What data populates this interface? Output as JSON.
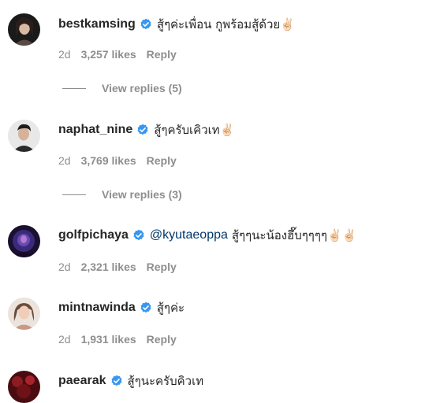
{
  "comments": [
    {
      "username": "bestkamsing",
      "mention": "",
      "text": "สู้ๆค่ะเพื่อน กูพร้อมสู้ด้วย✌🏻",
      "time": "2d",
      "likes": "3,257 likes",
      "reply_label": "Reply",
      "view_replies": "View replies (5)"
    },
    {
      "username": "naphat_nine",
      "mention": "",
      "text": "สู้ๆครับเคิวเท✌🏻",
      "time": "2d",
      "likes": "3,769 likes",
      "reply_label": "Reply",
      "view_replies": "View replies (3)"
    },
    {
      "username": "golfpichaya",
      "mention": "@kyutaeoppa",
      "text": "สู้ๆๆนะน้องฮึ๊บๆๆๆๆ✌🏻✌🏻",
      "time": "2d",
      "likes": "2,321 likes",
      "reply_label": "Reply",
      "view_replies": ""
    },
    {
      "username": "mintnawinda",
      "mention": "",
      "text": "สู้ๆค่ะ",
      "time": "2d",
      "likes": "1,931 likes",
      "reply_label": "Reply",
      "view_replies": ""
    },
    {
      "username": "paearak",
      "mention": "",
      "text": "สู้ๆนะครับคิวเท",
      "time": "",
      "likes": "",
      "reply_label": "",
      "view_replies": ""
    }
  ],
  "colors": {
    "verified_badge": "#3897f0",
    "username": "#262626",
    "secondary_text": "#8e8e8e",
    "mention": "#00376b"
  },
  "icons": {
    "verified": "verified-badge-icon"
  }
}
